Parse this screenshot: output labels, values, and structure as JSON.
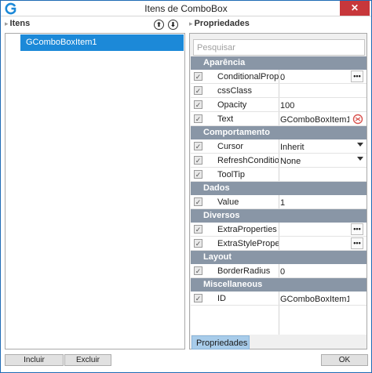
{
  "window": {
    "title": "Itens de ComboBox",
    "close_label": "✕"
  },
  "items_pane": {
    "title": "Itens",
    "items": [
      "GComboBoxItem1"
    ],
    "move_up_label": "⬆",
    "move_down_label": "⬇"
  },
  "properties_pane": {
    "title": "Propriedades",
    "search_placeholder": "Pesquisar",
    "categories": [
      {
        "name": "Aparência",
        "rows": [
          {
            "name": "ConditionalProperties",
            "value": "0",
            "editor": "ellipsis"
          },
          {
            "name": "cssClass",
            "value": "",
            "editor": "none"
          },
          {
            "name": "Opacity",
            "value": "100",
            "editor": "none"
          },
          {
            "name": "Text",
            "value": "GComboBoxItem1",
            "editor": "translate"
          }
        ]
      },
      {
        "name": "Comportamento",
        "rows": [
          {
            "name": "Cursor",
            "value": "Inherit",
            "editor": "dropdown"
          },
          {
            "name": "RefreshConditional",
            "value": "None",
            "editor": "dropdown"
          },
          {
            "name": "ToolTip",
            "value": "",
            "editor": "none"
          }
        ]
      },
      {
        "name": "Dados",
        "rows": [
          {
            "name": "Value",
            "value": "1",
            "editor": "none"
          }
        ]
      },
      {
        "name": "Diversos",
        "rows": [
          {
            "name": "ExtraProperties",
            "value": "",
            "editor": "ellipsis"
          },
          {
            "name": "ExtraStyleProperties",
            "value": "",
            "editor": "ellipsis"
          }
        ]
      },
      {
        "name": "Layout",
        "rows": [
          {
            "name": "BorderRadius",
            "value": "0",
            "editor": "none"
          }
        ]
      },
      {
        "name": "Miscellaneous",
        "rows": [
          {
            "name": "ID",
            "value": "GComboBoxItem1",
            "editor": "none"
          }
        ]
      }
    ],
    "tab_label": "Propriedades",
    "ellipsis_label": "•••",
    "check_mark": "✓"
  },
  "buttons": {
    "add": "Incluir",
    "remove": "Excluir",
    "ok": "OK"
  },
  "colors": {
    "accent": "#1c89d8",
    "category": "#8996a6",
    "close": "#c7373b",
    "tab": "#a8ccea"
  }
}
